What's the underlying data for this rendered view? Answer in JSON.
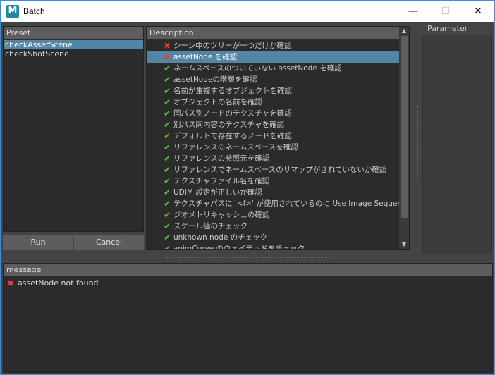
{
  "window": {
    "title": "Batch",
    "app_icon_letter": "M",
    "minimize": "—",
    "maximize": "☐",
    "close": "✕"
  },
  "preset": {
    "header": "Preset",
    "items": [
      {
        "label": "checkAssetScene",
        "selected": true
      },
      {
        "label": "checkShotScene",
        "selected": false
      }
    ],
    "run_label": "Run",
    "cancel_label": "Cancel"
  },
  "description": {
    "header": "Description",
    "items": [
      {
        "status": "ng",
        "label": "シーン中のツリーが一つだけか確認"
      },
      {
        "status": "ng",
        "label": "assetNode を確認",
        "selected": true
      },
      {
        "status": "ok",
        "label": "ネームスペースのついていない assetNode を確認"
      },
      {
        "status": "ok",
        "label": "assetNodeの階層を確認"
      },
      {
        "status": "ok",
        "label": "名前が重複するオブジェクトを確認"
      },
      {
        "status": "ok",
        "label": "オブジェクトの名前を確認"
      },
      {
        "status": "ok",
        "label": "同パス別ノードのテクスチャを確認"
      },
      {
        "status": "ok",
        "label": "別パス同内容のテクスチャを確認"
      },
      {
        "status": "ok",
        "label": "デフォルトで存在するノードを確認"
      },
      {
        "status": "ok",
        "label": "リファレンスのネームスペースを確認"
      },
      {
        "status": "ok",
        "label": "リファレンスの参照元を確認"
      },
      {
        "status": "ok",
        "label": "リファレンスでネームスペースのリマップがされていないか確認"
      },
      {
        "status": "ok",
        "label": "テクスチャファイル名を確認"
      },
      {
        "status": "ok",
        "label": "UDIM 設定が正しいか確認"
      },
      {
        "status": "ok",
        "label": "テクスチャパスに '<f>' が使用されているのに Use Image Sequence ..."
      },
      {
        "status": "ok",
        "label": "ジオメトリキャッシュの確認"
      },
      {
        "status": "ok",
        "label": "スケール値のチェック"
      },
      {
        "status": "ok",
        "label": "unknown node のチェック"
      },
      {
        "status": "ok",
        "label": "animCurve のウェイテッドをチェック"
      }
    ],
    "scroll_up": "▲",
    "scroll_down": "▼"
  },
  "parameter": {
    "header": "Parameter"
  },
  "message": {
    "header": "message",
    "items": [
      {
        "status": "ng",
        "label": "assetNode not found"
      }
    ]
  },
  "icons": {
    "ok": "✔",
    "ng": "✖"
  },
  "colors": {
    "selection": "#5285a6",
    "ok": "#55c232",
    "ng": "#e04040",
    "accent_border": "#3a8fd8"
  }
}
